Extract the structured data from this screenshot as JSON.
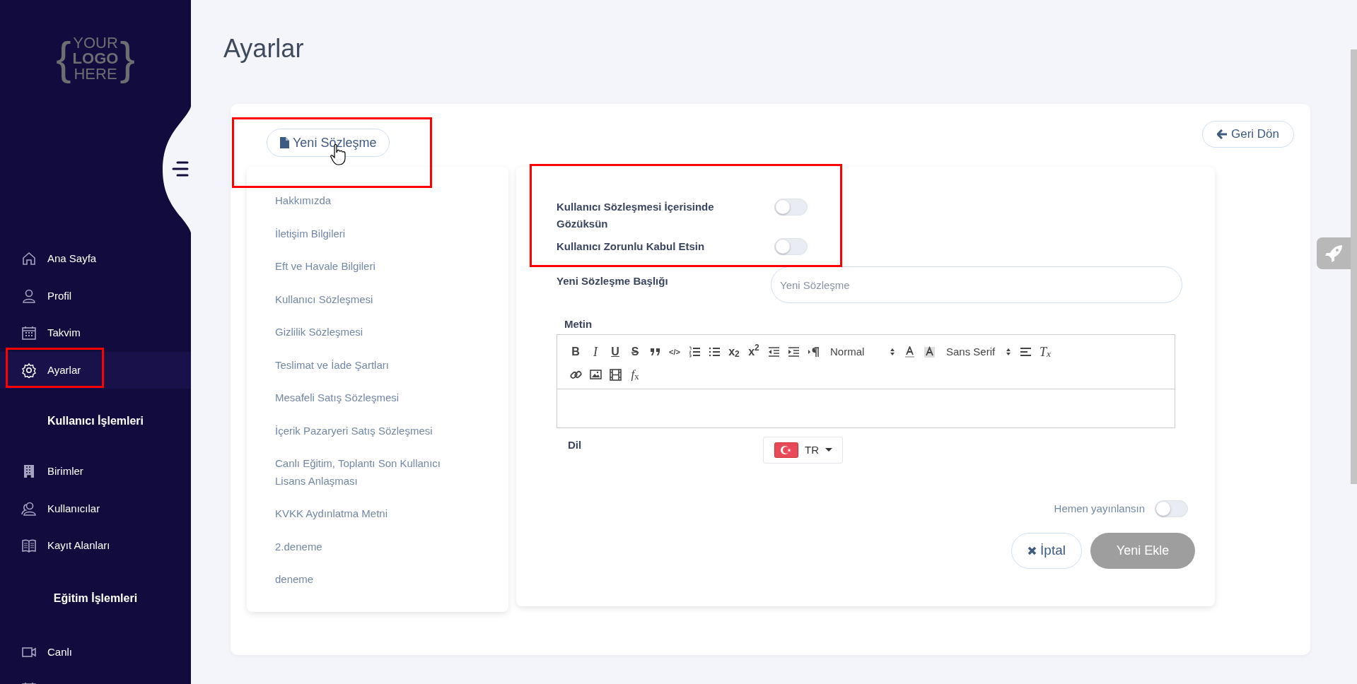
{
  "sidebar": {
    "logo": {
      "braces": [
        "{",
        "}"
      ],
      "lines": [
        "YOUR",
        "LOGO",
        "HERE"
      ]
    },
    "groups": [
      {
        "items": [
          {
            "label": "Ana Sayfa",
            "selected": false
          },
          {
            "label": "Profil",
            "selected": false
          },
          {
            "label": "Takvim",
            "selected": false
          },
          {
            "label": "Ayarlar",
            "selected": true
          }
        ]
      },
      {
        "heading": "Kullanıcı İşlemleri",
        "items": [
          {
            "label": "Birimler",
            "selected": false
          },
          {
            "label": "Kullanıcılar",
            "selected": false
          },
          {
            "label": "Kayıt Alanları",
            "selected": false
          }
        ]
      },
      {
        "heading": "Eğitim İşlemleri",
        "items": [
          {
            "label": "Canlı",
            "selected": false
          },
          {
            "selected": false
          }
        ]
      }
    ]
  },
  "page_title": "Ayarlar",
  "new_button": "Yeni Sözleşme",
  "back_button": "Geri Dön",
  "contracts": [
    {
      "label": "Hakkımızda",
      "selected": false
    },
    {
      "label": "İletişim Bilgileri",
      "selected": false
    },
    {
      "label": "Eft ve Havale Bilgileri",
      "selected": false
    },
    {
      "label": "Kullanıcı Sözleşmesi",
      "selected": false
    },
    {
      "label": "Gizlilik Sözleşmesi",
      "selected": false
    },
    {
      "label": "Teslimat ve İade Şartları",
      "selected": false
    },
    {
      "label": "Mesafeli Satış Sözleşmesi",
      "selected": false
    },
    {
      "label": "İçerik Pazaryeri Satış Sözleşmesi",
      "selected": false
    },
    {
      "label": "Canlı Eğitim, Toplantı Son Kullanıcı Lisans Anlaşması",
      "selected": false
    },
    {
      "label": "KVKK Aydınlatma Metni",
      "selected": false
    },
    {
      "label": "2.deneme",
      "selected": false
    },
    {
      "label": "deneme",
      "selected": false
    }
  ],
  "switches": [
    {
      "label": "Kullanıcı Sözleşmesi İçerisinde Gözüksün",
      "on": false
    },
    {
      "label": "Kullanıcı Zorunlu Kabul Etsin",
      "on": false
    }
  ],
  "title_field": {
    "label": "Yeni Sözleşme Başlığı",
    "placeholder": "Yeni Sözleşme"
  },
  "editor": {
    "label": "Metin",
    "toolbar": [
      {
        "kind": "bold",
        "text": "B"
      },
      {
        "kind": "italic",
        "text": "I"
      },
      {
        "kind": "underline",
        "text": "U"
      },
      {
        "kind": "strike",
        "text": "S"
      },
      {
        "kind": "icon"
      },
      {
        "kind": "code",
        "text": "</>"
      },
      {
        "kind": "icon"
      },
      {
        "kind": "icon"
      },
      {
        "kind": "bold",
        "text": "x$_{2}$"
      },
      {
        "kind": "bold",
        "text": "x$^{2}$"
      },
      {
        "kind": "icon"
      },
      {
        "kind": "icon"
      },
      {
        "kind": "icon"
      },
      {
        "kind": "select",
        "text": "Normal"
      },
      {
        "kind": "icon"
      },
      {
        "kind": "icon"
      },
      {
        "kind": "select",
        "text": "Sans Serif"
      },
      {
        "kind": "icon"
      },
      {
        "kind": "italic",
        "text": "T$_{x}$"
      },
      {
        "kind": "break"
      },
      {
        "kind": "icon"
      },
      {
        "kind": "icon"
      },
      {
        "kind": "icon"
      },
      {
        "kind": "serif",
        "text": "*f*$_{x}$"
      }
    ]
  },
  "language": {
    "label": "Dil",
    "value": "TR"
  },
  "publish": {
    "label": "Hemen yayınlansın",
    "on": false
  },
  "cancel_button": "İptal",
  "submit_button": {
    "label": "Yeni Ekle",
    "disabled": true
  }
}
